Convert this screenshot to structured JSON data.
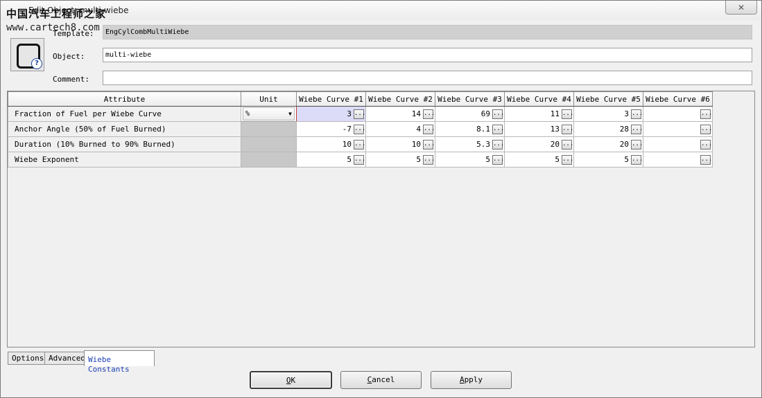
{
  "window": {
    "title": "Edit Object: multi-wiebe",
    "watermark": "中国汽车工程师之家",
    "watermark_url": "www.cartech8.com",
    "close_glyph": "✕"
  },
  "form": {
    "template_label": "Template:",
    "template_value": "EngCylCombMultiWiebe",
    "object_label": "Object:",
    "object_value": "multi-wiebe",
    "comment_label": "Comment:",
    "comment_value": ""
  },
  "grid": {
    "headers": [
      "Attribute",
      "Unit",
      "Wiebe Curve #1",
      "Wiebe Curve #2",
      "Wiebe Curve #3",
      "Wiebe Curve #4",
      "Wiebe Curve #5",
      "Wiebe Curve #6"
    ],
    "rows": [
      {
        "attribute": "Fraction of Fuel per Wiebe Curve",
        "unit": "%",
        "values": [
          "3",
          "14",
          "69",
          "11",
          "3",
          ""
        ]
      },
      {
        "attribute": "Anchor Angle (50% of Fuel Burned)",
        "unit": "",
        "values": [
          "-7",
          "4",
          "8.1",
          "13",
          "28",
          ""
        ]
      },
      {
        "attribute": "Duration (10% Burned to 90% Burned)",
        "unit": "",
        "values": [
          "10",
          "10",
          "5.3",
          "20",
          "20",
          ""
        ]
      },
      {
        "attribute": "Wiebe Exponent",
        "unit": "",
        "values": [
          "5",
          "5",
          "5",
          "5",
          "5",
          ""
        ]
      }
    ],
    "dots_label": "..."
  },
  "tabs": [
    {
      "label": "Options",
      "active": false
    },
    {
      "label": "Advanced",
      "active": false
    },
    {
      "label": "Wiebe Constants",
      "active": true
    }
  ],
  "buttons": {
    "ok_mnemonic": "O",
    "ok_rest": "K",
    "cancel_mnemonic": "C",
    "cancel_rest": "ancel",
    "apply_mnemonic": "A",
    "apply_rest": "pply"
  },
  "colors": {
    "active_cell": "#dcdcf8",
    "active_tab_text": "#1c3fb4",
    "unit_divider": "#c0392b"
  }
}
